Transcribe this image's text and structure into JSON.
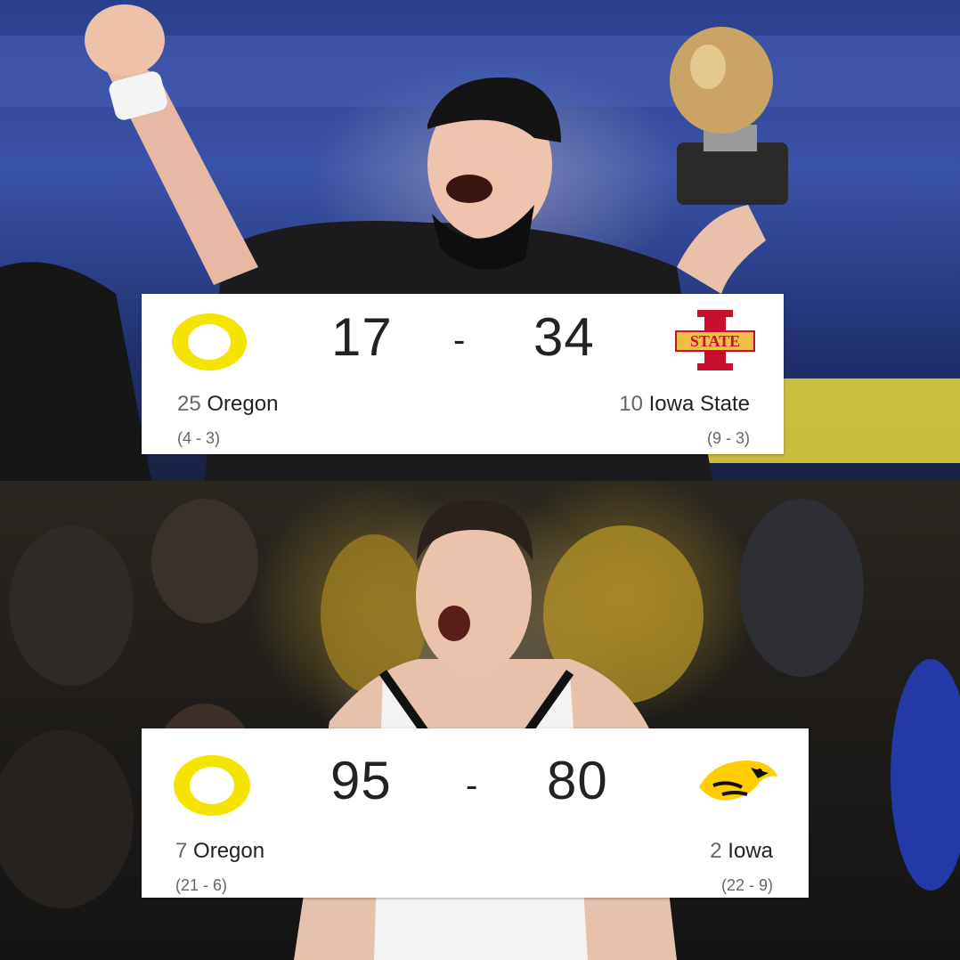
{
  "football": {
    "home": {
      "rank": "25",
      "name": "Oregon",
      "record": "(4 - 3)",
      "score": "17"
    },
    "away": {
      "rank": "10",
      "name": "Iowa State",
      "record": "(9 - 3)",
      "score": "34"
    },
    "separator": "-",
    "away_logo_text": "STATE"
  },
  "basketball": {
    "home": {
      "rank": "7",
      "name": "Oregon",
      "record": "(21 - 6)",
      "score": "95"
    },
    "away": {
      "rank": "2",
      "name": "Iowa",
      "record": "(22 - 9)",
      "score": "80"
    },
    "separator": "-"
  },
  "colors": {
    "oregon_yellow": "#f5e400",
    "iowa_state_red": "#c8102e",
    "iowa_state_gold": "#f1be48",
    "iowa_gold": "#ffcd00",
    "card_bg": "#ffffff"
  }
}
